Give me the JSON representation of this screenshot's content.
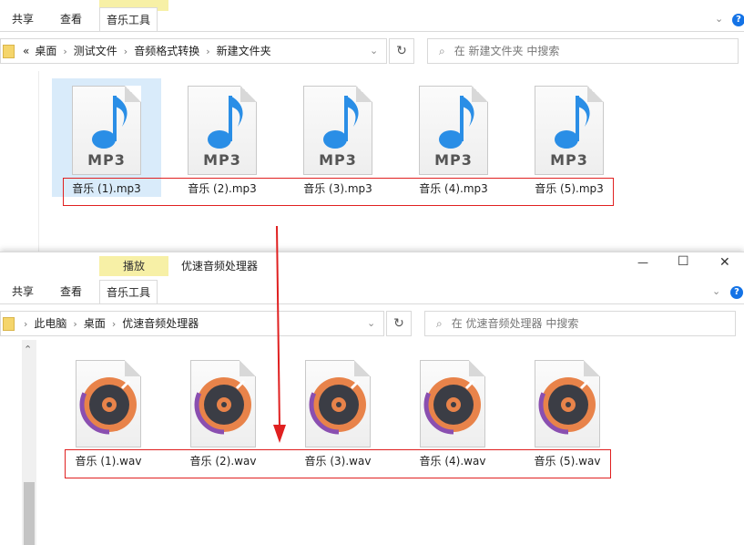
{
  "top_window": {
    "ribbon": {
      "tabs": [
        "共享",
        "查看",
        "音乐工具"
      ],
      "context_group_label": ""
    },
    "address": {
      "prefix": "«",
      "crumbs": [
        "桌面",
        "测试文件",
        "音频格式转换",
        "新建文件夹"
      ]
    },
    "search_placeholder": "在 新建文件夹 中搜索",
    "files": [
      "音乐 (1).mp3",
      "音乐 (2).mp3",
      "音乐 (3).mp3",
      "音乐 (4).mp3",
      "音乐 (5).mp3"
    ],
    "file_icon_label": "MP3",
    "selected_index": 0
  },
  "bottom_window": {
    "title": "优速音频处理器",
    "ribbon": {
      "context_group_label": "播放",
      "tabs": [
        "共享",
        "查看",
        "音乐工具"
      ]
    },
    "address": {
      "crumbs": [
        "此电脑",
        "桌面",
        "优速音频处理器"
      ]
    },
    "search_placeholder": "在 优速音频处理器 中搜索",
    "files": [
      "音乐 (1).wav",
      "音乐 (2).wav",
      "音乐 (3).wav",
      "音乐 (4).wav",
      "音乐 (5).wav"
    ],
    "window_controls": {
      "minimize": "—",
      "maximize": "☐",
      "close": "✕"
    }
  },
  "icons": {
    "help": "?",
    "refresh": "↻",
    "search": "⌕",
    "chevron_down": "⌄",
    "scroll_up": "⌃"
  },
  "colors": {
    "context_tab": "#f7f0a6",
    "annotation": "#e02020",
    "help_icon": "#1473e6",
    "selection": "#d9ebfa"
  }
}
